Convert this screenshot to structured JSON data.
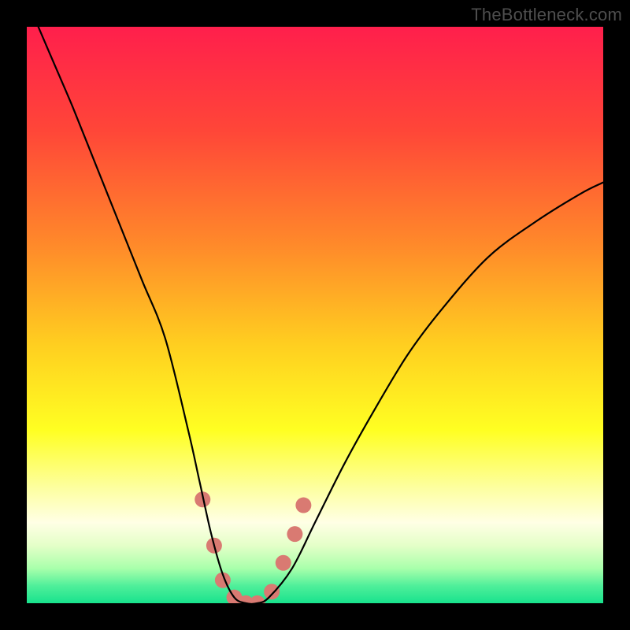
{
  "watermark": "TheBottleneck.com",
  "chart_data": {
    "type": "line",
    "title": "",
    "xlabel": "",
    "ylabel": "",
    "xlim": [
      0,
      100
    ],
    "ylim": [
      0,
      100
    ],
    "grid": false,
    "background_gradient_stops": [
      {
        "pos": 0.0,
        "color": "#ff1f4c"
      },
      {
        "pos": 0.18,
        "color": "#ff4638"
      },
      {
        "pos": 0.38,
        "color": "#ff8a2a"
      },
      {
        "pos": 0.55,
        "color": "#ffce20"
      },
      {
        "pos": 0.7,
        "color": "#ffff22"
      },
      {
        "pos": 0.8,
        "color": "#fdffa0"
      },
      {
        "pos": 0.86,
        "color": "#ffffe5"
      },
      {
        "pos": 0.9,
        "color": "#e4ffc8"
      },
      {
        "pos": 0.94,
        "color": "#a8ffab"
      },
      {
        "pos": 0.97,
        "color": "#4fef9a"
      },
      {
        "pos": 1.0,
        "color": "#18e28d"
      }
    ],
    "series": [
      {
        "name": "bottleneck-curve",
        "stroke": "#000000",
        "stroke_width": 2.2,
        "x": [
          2,
          5,
          8,
          12,
          16,
          20,
          24,
          28,
          30,
          32,
          34,
          36,
          38,
          40,
          42,
          46,
          50,
          55,
          60,
          66,
          72,
          80,
          88,
          96,
          100
        ],
        "y": [
          100,
          93,
          86,
          76,
          66,
          56,
          46,
          30,
          21,
          12,
          5,
          1,
          0,
          0,
          1,
          6,
          14,
          24,
          33,
          43,
          51,
          60,
          66,
          71,
          73
        ]
      }
    ],
    "markers": {
      "name": "highlight-dots",
      "color": "#d97a72",
      "radius": 10,
      "points": [
        {
          "x": 30.5,
          "y": 18
        },
        {
          "x": 32.5,
          "y": 10
        },
        {
          "x": 34.0,
          "y": 4
        },
        {
          "x": 36.0,
          "y": 1
        },
        {
          "x": 38.0,
          "y": 0
        },
        {
          "x": 40.0,
          "y": 0
        },
        {
          "x": 42.5,
          "y": 2
        },
        {
          "x": 44.5,
          "y": 7
        },
        {
          "x": 46.5,
          "y": 12
        },
        {
          "x": 48.0,
          "y": 17
        }
      ]
    }
  }
}
